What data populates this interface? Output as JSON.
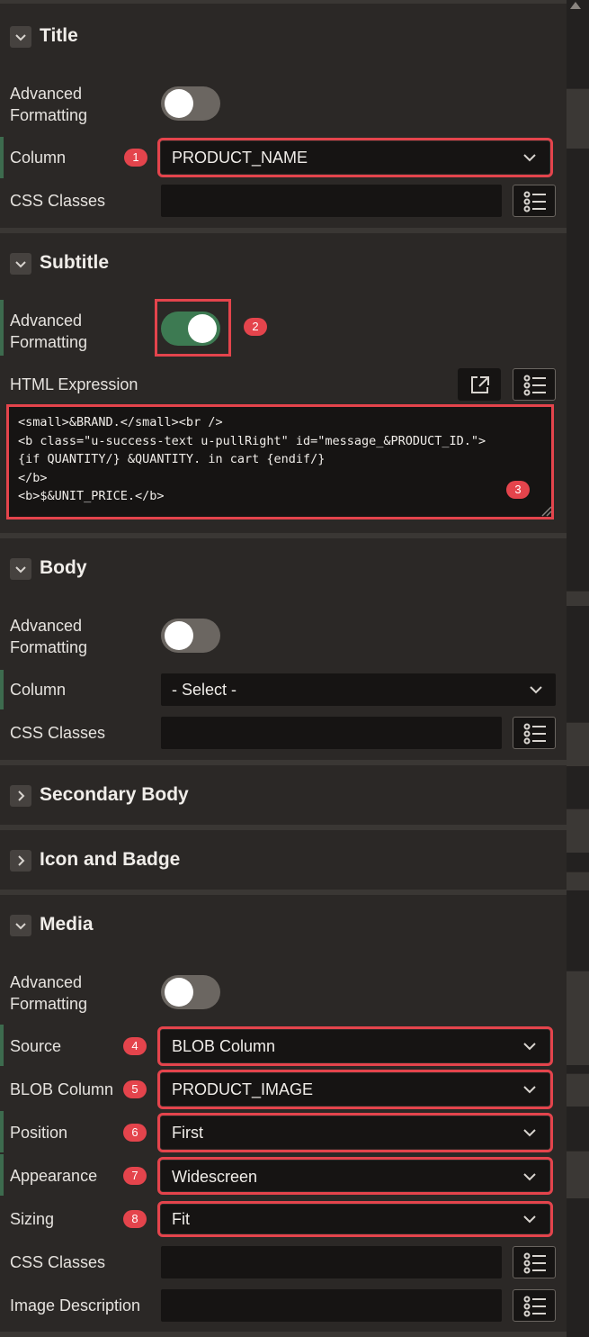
{
  "title_section": {
    "heading": "Title",
    "advanced_formatting_label": "Advanced Formatting",
    "advanced_formatting_on": false,
    "column_label": "Column",
    "column_value": "PRODUCT_NAME",
    "column_badge": "1",
    "css_classes_label": "CSS Classes"
  },
  "subtitle_section": {
    "heading": "Subtitle",
    "advanced_formatting_label": "Advanced Formatting",
    "advanced_formatting_on": true,
    "toggle_badge": "2",
    "html_expression_label": "HTML Expression",
    "html_expression_value": "<small>&BRAND.</small><br />\n<b class=\"u-success-text u-pullRight\" id=\"message_&PRODUCT_ID.\">\n{if QUANTITY/} &QUANTITY. in cart {endif/}\n</b>\n<b>$&UNIT_PRICE.</b>",
    "code_badge": "3"
  },
  "body_section": {
    "heading": "Body",
    "advanced_formatting_label": "Advanced Formatting",
    "advanced_formatting_on": false,
    "column_label": "Column",
    "column_value": "- Select -",
    "css_classes_label": "CSS Classes"
  },
  "secondary_body_section": {
    "heading": "Secondary Body"
  },
  "icon_badge_section": {
    "heading": "Icon and Badge"
  },
  "media_section": {
    "heading": "Media",
    "advanced_formatting_label": "Advanced Formatting",
    "advanced_formatting_on": false,
    "source_label": "Source",
    "source_value": "BLOB Column",
    "source_badge": "4",
    "blob_column_label": "BLOB Column",
    "blob_column_value": "PRODUCT_IMAGE",
    "blob_column_badge": "5",
    "position_label": "Position",
    "position_value": "First",
    "position_badge": "6",
    "appearance_label": "Appearance",
    "appearance_value": "Widescreen",
    "appearance_badge": "7",
    "sizing_label": "Sizing",
    "sizing_value": "Fit",
    "sizing_badge": "8",
    "css_classes_label": "CSS Classes",
    "image_description_label": "Image Description"
  },
  "icons": {
    "expanded": "chevron-down-icon",
    "collapsed": "chevron-right-icon",
    "dropdown": "chevron-down-icon",
    "list": "list-icon",
    "expand": "expand-dialog-icon"
  },
  "colors": {
    "highlight": "#e4444c",
    "toggle_on": "#3d7a52",
    "background": "#2b2826"
  }
}
